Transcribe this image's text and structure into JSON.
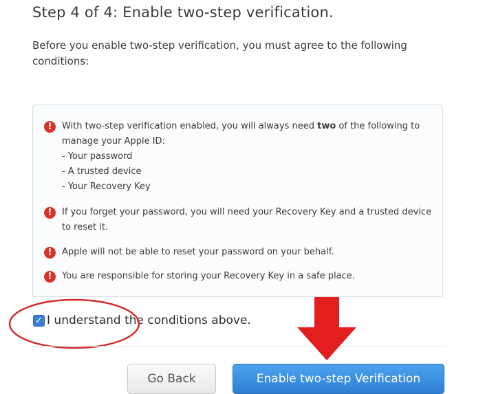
{
  "header": {
    "title": "Step 4 of 4: Enable two-step verification."
  },
  "intro": {
    "text": "Before you enable two-step verification, you must agree to the following conditions:"
  },
  "conditions": {
    "item1": {
      "before": "With two-step verification enabled, you will always need ",
      "bold": "two",
      "after": " of the following to manage your Apple ID:",
      "list": [
        "- Your password",
        "- A trusted device",
        "- Your Recovery Key"
      ]
    },
    "item2": "If you forget your password, you will need your Recovery Key and a trusted device to reset it.",
    "item3": "Apple will not be able to reset your password on your behalf.",
    "item4": "You are responsible for storing your Recovery Key in a safe place."
  },
  "agree": {
    "label": "I understand the conditions above.",
    "checked": true
  },
  "buttons": {
    "back_label": "Go Back",
    "enable_label": "Enable two-step Verification"
  },
  "colors": {
    "warning_icon": "#d7322c",
    "primary_button": "#3a8ee0",
    "annotation_red": "#d42a2a",
    "checkbox": "#3b7fd1"
  },
  "icons": {
    "warning": "exclamation-circle-icon",
    "check": "checkmark-icon"
  }
}
